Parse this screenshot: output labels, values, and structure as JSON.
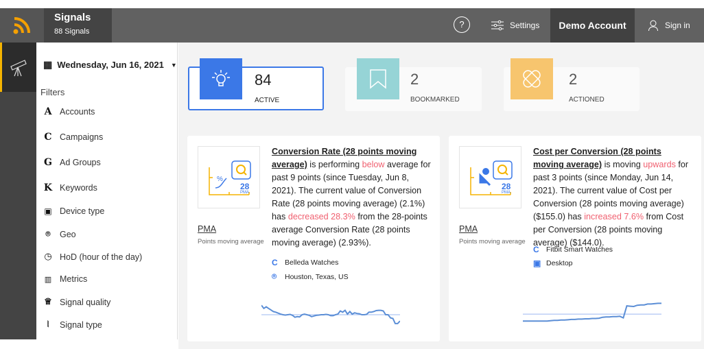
{
  "header": {
    "title": "Signals",
    "subtitle": "88 Signals",
    "help_label": "?",
    "settings_label": "Settings",
    "account_label": "Demo Account",
    "signin_label": "Sign in"
  },
  "sidebar": {
    "date": "Wednesday, Jun 16, 2021",
    "filters_label": "Filters",
    "items": [
      {
        "icon": "A",
        "label": "Accounts"
      },
      {
        "icon": "C",
        "label": "Campaigns"
      },
      {
        "icon": "G",
        "label": "Ad Groups"
      },
      {
        "icon": "K",
        "label": "Keywords"
      },
      {
        "icon": "device-icon",
        "label": "Device type"
      },
      {
        "icon": "pin-icon",
        "label": "Geo"
      },
      {
        "icon": "clock-icon",
        "label": "HoD (hour of the day)"
      },
      {
        "icon": "metrics-icon",
        "label": "Metrics"
      },
      {
        "icon": "trophy-icon",
        "label": "Signal quality"
      },
      {
        "icon": "rss-icon",
        "label": "Signal type"
      }
    ]
  },
  "stats": [
    {
      "count": "84",
      "label": "Active",
      "color": "#3b78e7"
    },
    {
      "count": "2",
      "label": "Bookmarked",
      "color": "#96d4d6"
    },
    {
      "count": "2",
      "label": "Actioned",
      "color": "#f7c56e"
    }
  ],
  "cards": [
    {
      "pma": "PMA",
      "pma_sub": "Points moving average",
      "icon_num": "28",
      "icon_sub": "PMA",
      "metric": "Conversion Rate (28 points moving average)",
      "t1": " is performing ",
      "hl1": "below",
      "t2": " average for past 9 points (since Tuesday, Jun 8, 2021). The current value of Conversion Rate (28 points moving average) (2.1%) has ",
      "hl2": "decreased 28.3%",
      "t3": " from the 28-points average Conversion Rate (28 points moving average) (2.93%).",
      "tags": [
        {
          "icon": "campaign-icon",
          "label": "Belleda Watches"
        },
        {
          "icon": "pin-icon",
          "label": "Houston, Texas, US"
        }
      ],
      "sparkline": {
        "baseline": 50,
        "values": [
          80,
          70,
          75,
          70,
          65,
          60,
          58,
          55,
          52,
          50,
          49,
          50,
          51,
          48,
          42,
          44,
          43,
          50,
          52,
          50,
          48,
          44,
          46,
          48,
          49,
          50,
          50,
          51,
          50,
          47,
          47,
          50,
          52,
          62,
          58,
          64,
          52,
          60,
          52,
          56,
          54,
          53,
          50,
          50,
          51,
          58,
          58,
          60,
          63,
          64,
          64,
          62,
          50,
          50,
          40,
          38,
          22,
          22,
          30
        ]
      }
    },
    {
      "pma": "PMA",
      "pma_sub": "Points moving average",
      "icon_num": "28",
      "icon_sub": "PMA",
      "metric": "Cost per Conversion (28 points moving average)",
      "t1": " is moving ",
      "hl1": "upwards",
      "t2": " for past 3 points (since Monday, Jun 14, 2021). The current value of Cost per Conversion (28 points moving average) ($155.0) has ",
      "hl2": "increased 7.6%",
      "t3": " from Cost per Conversion (28 points moving average) ($144.0).",
      "tags": [
        {
          "icon": "campaign-icon",
          "label": "Fitbit Smart Watches"
        },
        {
          "icon": "device-icon",
          "label": "Desktop"
        }
      ],
      "sparkline": {
        "baseline": 52,
        "values": [
          30,
          30,
          30,
          30,
          30,
          30,
          30,
          30,
          31,
          32,
          32,
          33,
          33,
          34,
          35,
          35,
          36,
          36,
          37,
          37,
          38,
          38,
          39,
          42,
          43,
          43,
          44,
          44,
          45,
          40,
          78,
          77,
          76,
          80,
          81,
          81,
          84,
          84,
          85,
          86,
          86
        ]
      }
    }
  ]
}
